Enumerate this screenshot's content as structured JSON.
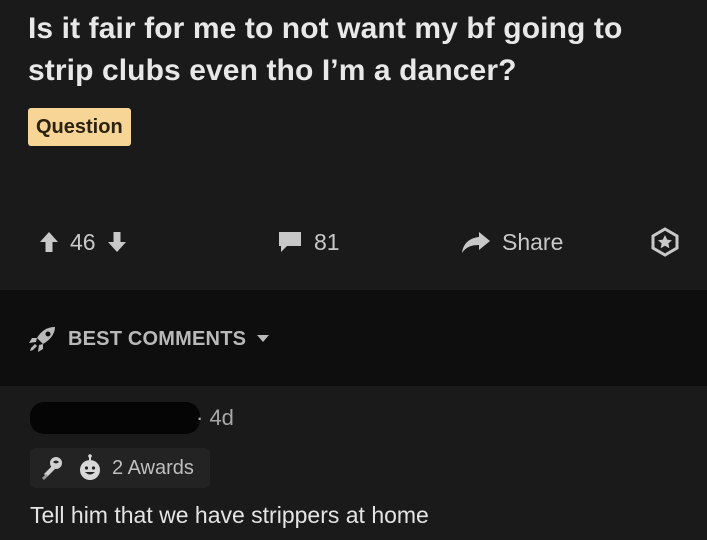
{
  "post": {
    "title": "Is it fair for me to not want my bf going to strip clubs even tho I’m a dancer?",
    "flair": "Question",
    "score": "46",
    "comments_count": "81",
    "share_label": "Share"
  },
  "comments_section": {
    "sort_label": "BEST COMMENTS"
  },
  "comment": {
    "meta": "· 4d",
    "awards": "2 Awards",
    "body": "Tell him that we have strippers at home"
  },
  "colors": {
    "background": "#1a1a1b",
    "sort_bar": "#0e0e0f",
    "flair_bg": "#f7d596",
    "text": "#e8e8e8",
    "muted": "#a8a8a8"
  },
  "icons": [
    "upvote-icon",
    "downvote-icon",
    "comment-icon",
    "share-icon",
    "award-icon",
    "rocket-icon",
    "chevron-down-icon",
    "award-rose-icon",
    "award-face-icon"
  ]
}
